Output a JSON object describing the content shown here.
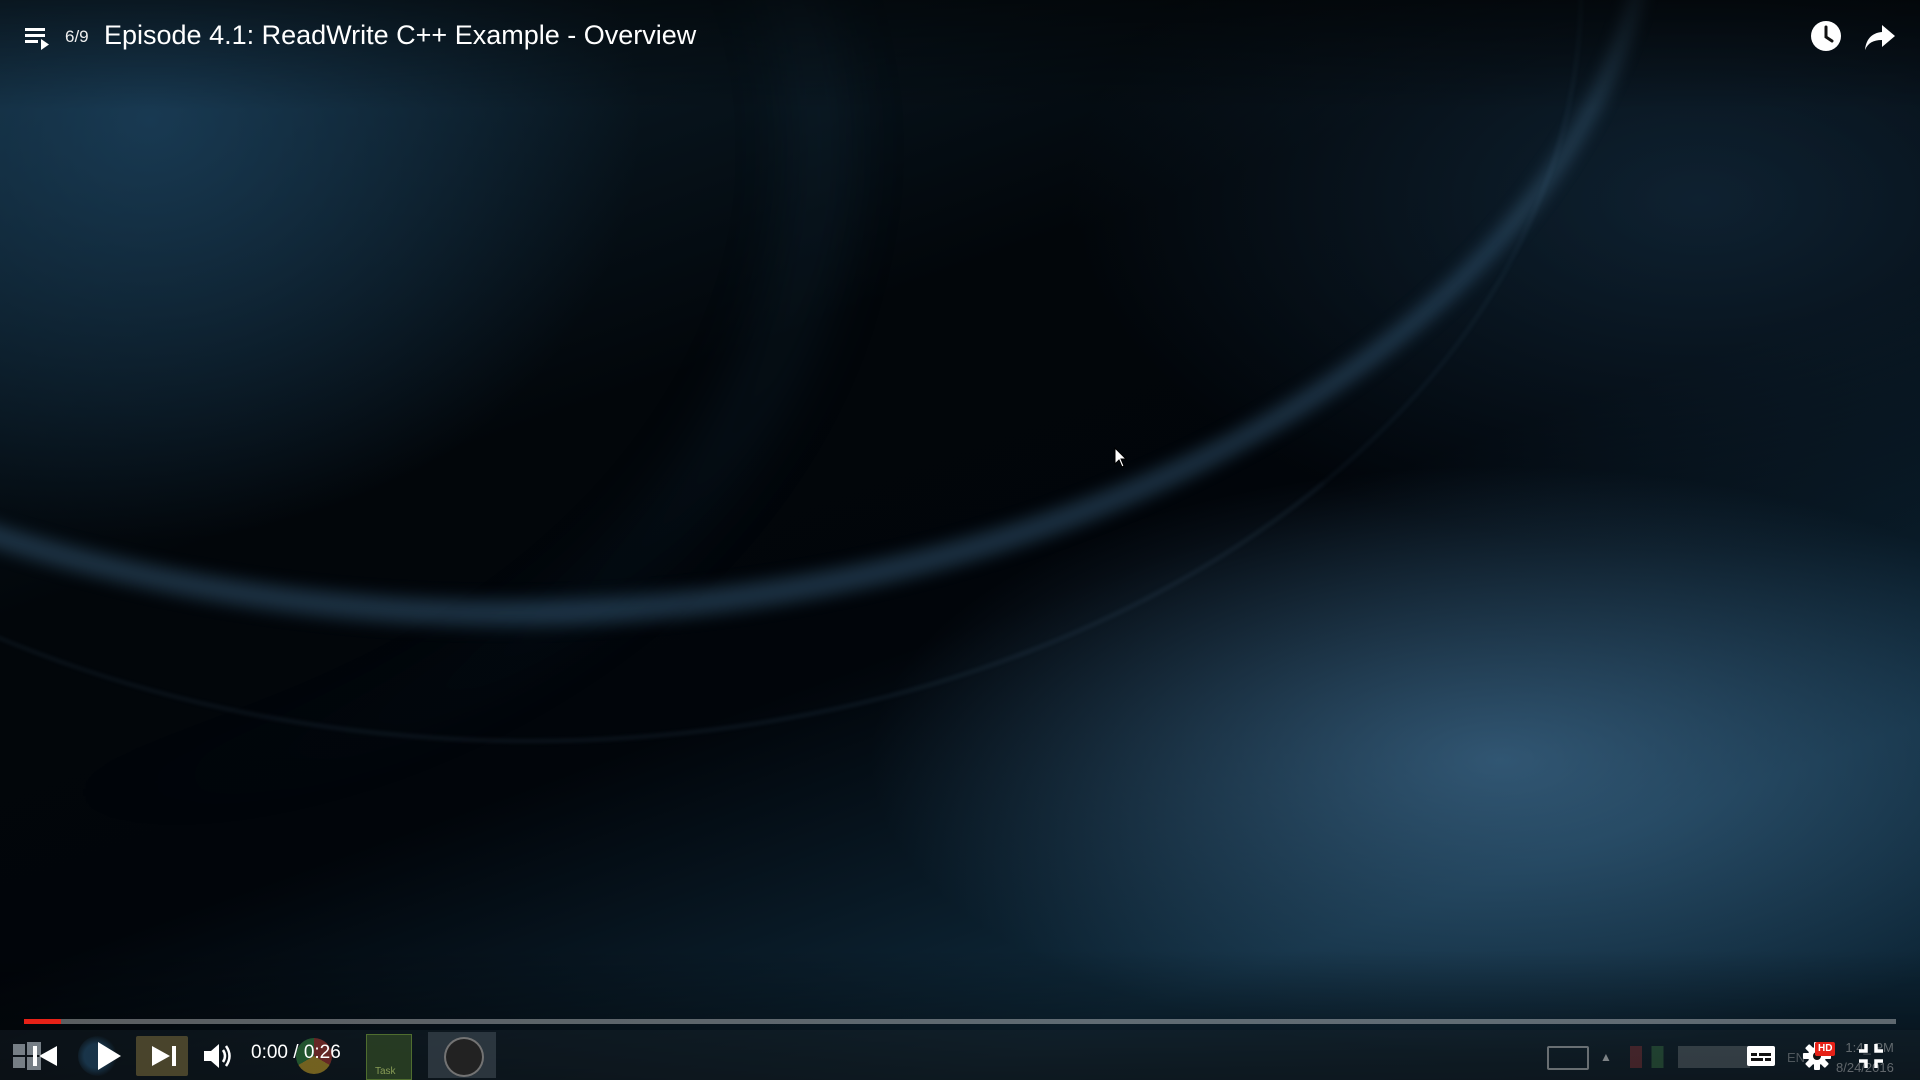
{
  "player": {
    "playlist_position": "6/9",
    "title": "Episode 4.1: ReadWrite C++ Example - Overview",
    "current_time": "0:00",
    "duration": "0:26",
    "time_separator": " / ",
    "progress_fraction": 0.02,
    "hd_badge": "HD",
    "accent_color": "#e62117"
  },
  "icons": {
    "playlist": "playlist-icon",
    "watch_later": "clock-icon",
    "share": "share-arrow-icon",
    "previous": "skip-previous-icon",
    "play": "play-icon",
    "next": "skip-next-icon",
    "volume": "volume-icon",
    "subtitles": "subtitles-icon",
    "settings": "gear-icon",
    "exit_fullscreen": "exit-fullscreen-icon",
    "cursor": "mouse-pointer-icon"
  },
  "video_content": {
    "taskbar_task_label": "Task",
    "taskbar_lang": "EN",
    "taskbar_time": "1:4_ PM",
    "taskbar_date": "8/24/2016"
  }
}
